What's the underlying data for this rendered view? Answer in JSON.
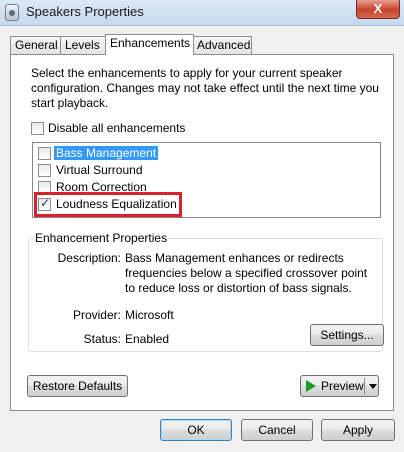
{
  "window": {
    "title": "Speakers Properties",
    "close_glyph": "X"
  },
  "tabs": [
    {
      "label": "General"
    },
    {
      "label": "Levels"
    },
    {
      "label": "Enhancements"
    },
    {
      "label": "Advanced"
    }
  ],
  "active_tab": "Enhancements",
  "enhancements": {
    "intro": "Select the enhancements to apply for your current speaker configuration. Changes may not take effect until the next time you start playback.",
    "disable_all_label": "Disable all enhancements",
    "disable_all_checked": false,
    "items": [
      {
        "label": "Bass Management",
        "checked": false,
        "selected": true
      },
      {
        "label": "Virtual Surround",
        "checked": false,
        "selected": false
      },
      {
        "label": "Room Correction",
        "checked": false,
        "selected": false
      },
      {
        "label": "Loudness Equalization",
        "checked": true,
        "selected": false
      }
    ]
  },
  "properties": {
    "group_title": "Enhancement Properties",
    "description_label": "Description:",
    "description_value": "Bass Management enhances or redirects frequencies below a specified crossover point to reduce loss or distortion of bass signals.",
    "provider_label": "Provider:",
    "provider_value": "Microsoft",
    "status_label": "Status:",
    "status_value": "Enabled",
    "settings_button": "Settings..."
  },
  "buttons": {
    "restore_defaults": "Restore Defaults",
    "preview": "Preview",
    "ok": "OK",
    "cancel": "Cancel",
    "apply": "Apply"
  },
  "colors": {
    "selection": "#3399ff",
    "highlight_box": "#d6232d",
    "play_icon": "#1e9a2a"
  }
}
